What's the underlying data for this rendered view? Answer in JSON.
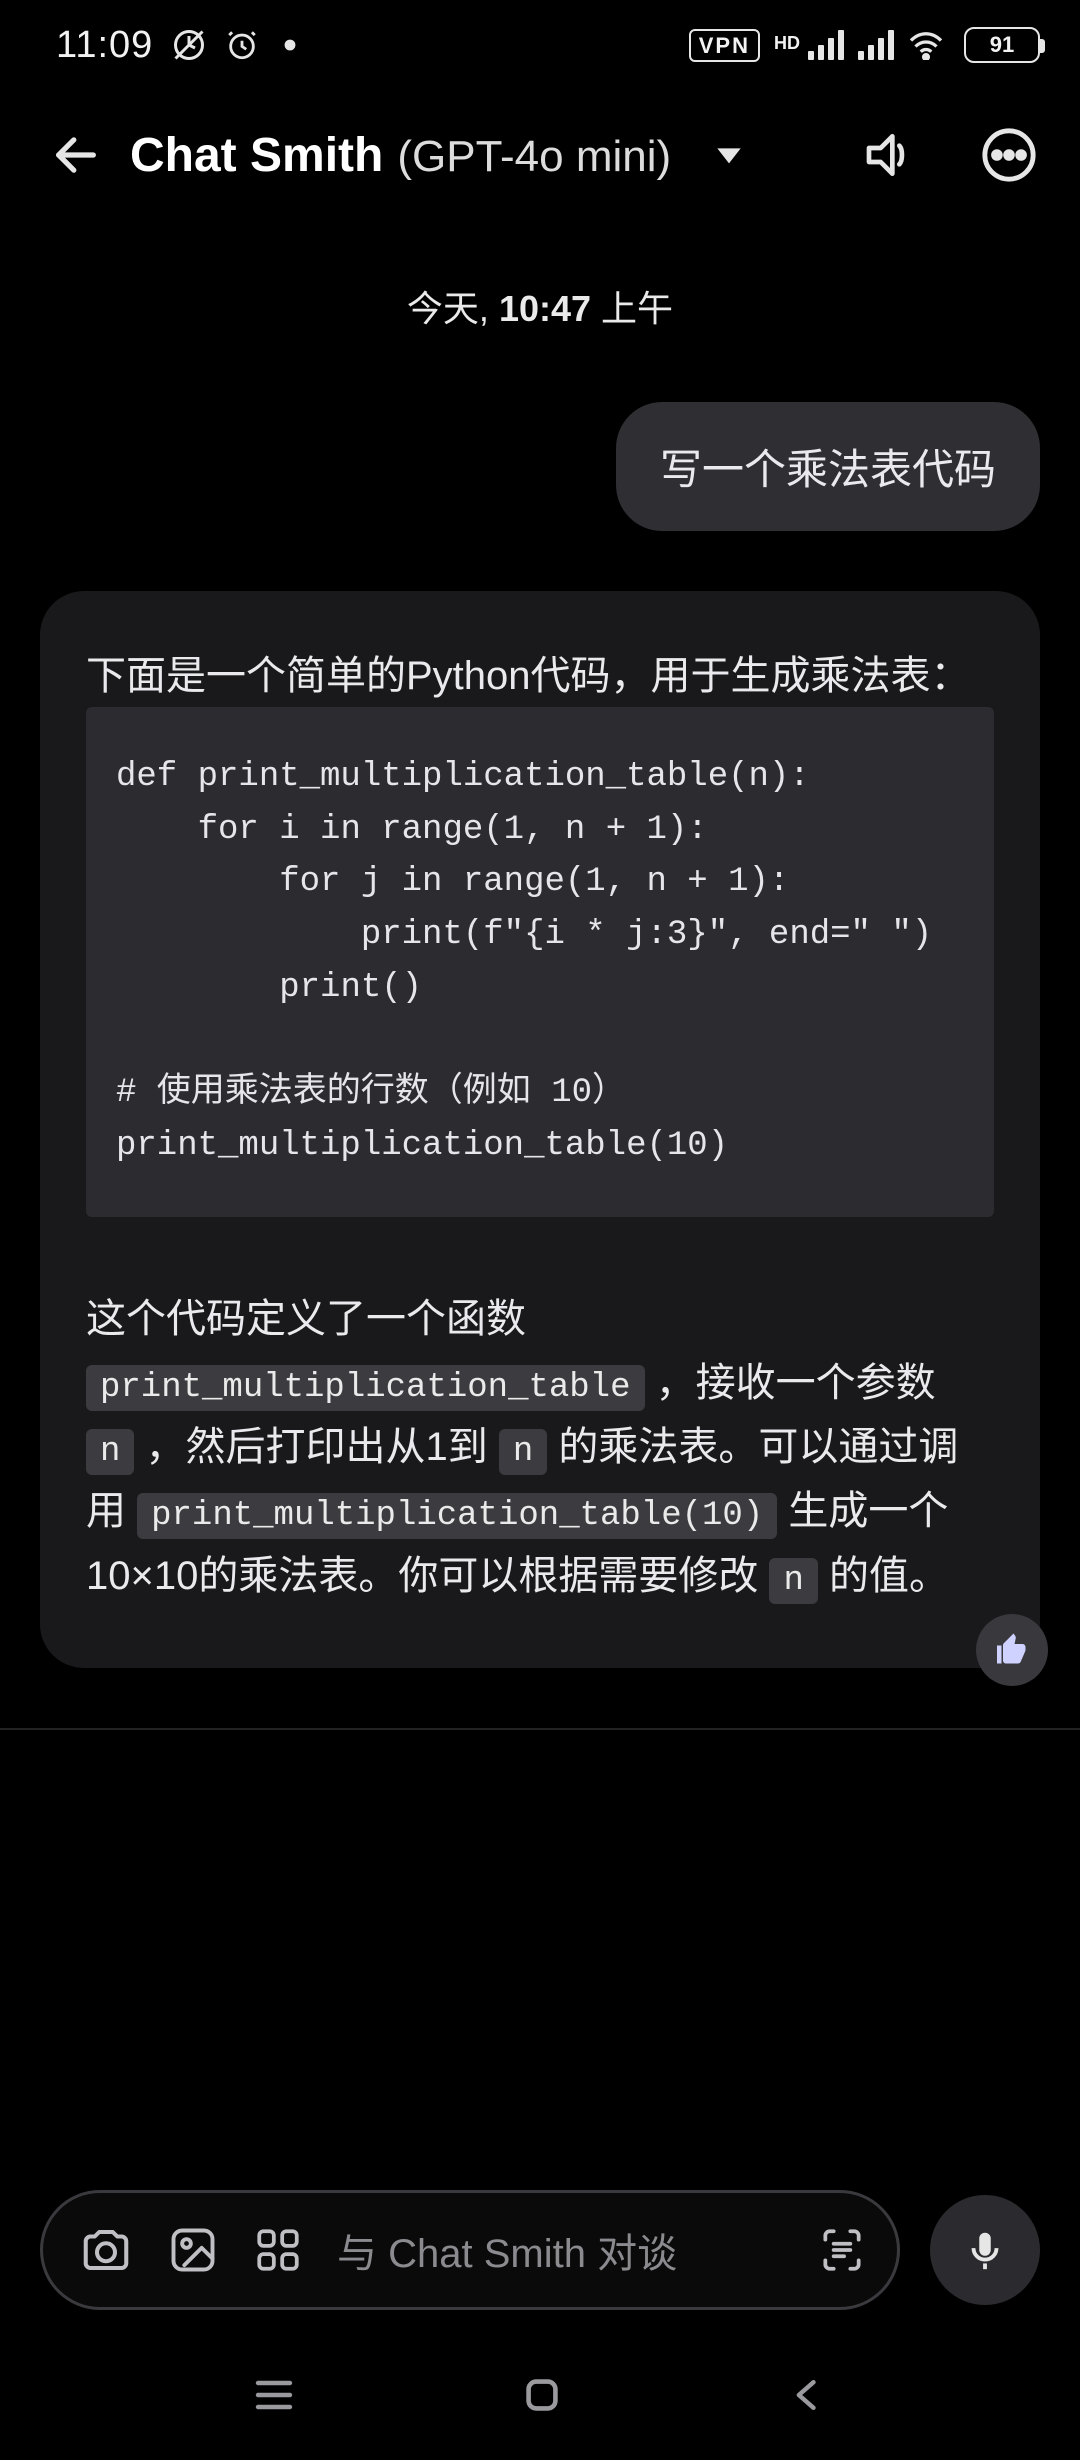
{
  "status": {
    "time": "11:09",
    "vpn": "VPN",
    "hd": "HD",
    "battery": "91"
  },
  "header": {
    "title": "Chat Smith",
    "subtitle": "(GPT-4o mini)"
  },
  "timestamp": {
    "day": "今天,",
    "time": "10:47",
    "ampm": "上午"
  },
  "messages": {
    "user1": "写一个乘法表代码",
    "bot1": {
      "intro": "下面是一个简单的Python代码，用于生成乘法表：",
      "code": "def print_multiplication_table(n):\n    for i in range(1, n + 1):\n        for j in range(1, n + 1):\n            print(f\"{i * j:3}\", end=\" \")\n        print()\n\n# 使用乘法表的行数（例如 10）\nprint_multiplication_table(10)",
      "explain": {
        "t1": "这个代码定义了一个函数 ",
        "c1": "print_multiplication_table",
        "t2": " ，接收一个参数 ",
        "c2": "n",
        "t3": " ，然后打印出从1到 ",
        "c3": "n",
        "t4": " 的乘法表。可以通过调用 ",
        "c4": "print_multiplication_table(10)",
        "t5": " 生成一个10×10的乘法表。你可以根据需要修改 ",
        "c5": "n",
        "t6": " 的值。"
      }
    }
  },
  "input": {
    "placeholder": "与 Chat Smith 对谈"
  }
}
